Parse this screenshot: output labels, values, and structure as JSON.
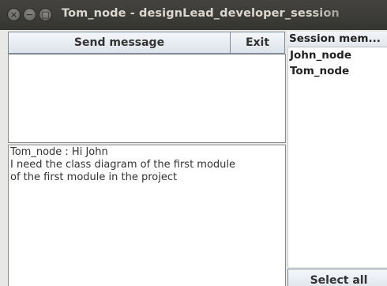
{
  "window": {
    "title": "Tom_node - designLead_developer_session",
    "close_glyph": "×",
    "minimize_glyph": "−",
    "maximize_glyph": "□"
  },
  "toolbar": {
    "send_label": "Send message",
    "exit_label": "Exit"
  },
  "compose": {
    "value": ""
  },
  "chat": {
    "lines": [
      "Tom_node : Hi John",
      "I need the class diagram of the first module",
      "of the first module in the project"
    ]
  },
  "members": {
    "header": "Session mem...",
    "items": [
      "John_node",
      "Tom_node"
    ],
    "select_all_label": "Select all"
  }
}
